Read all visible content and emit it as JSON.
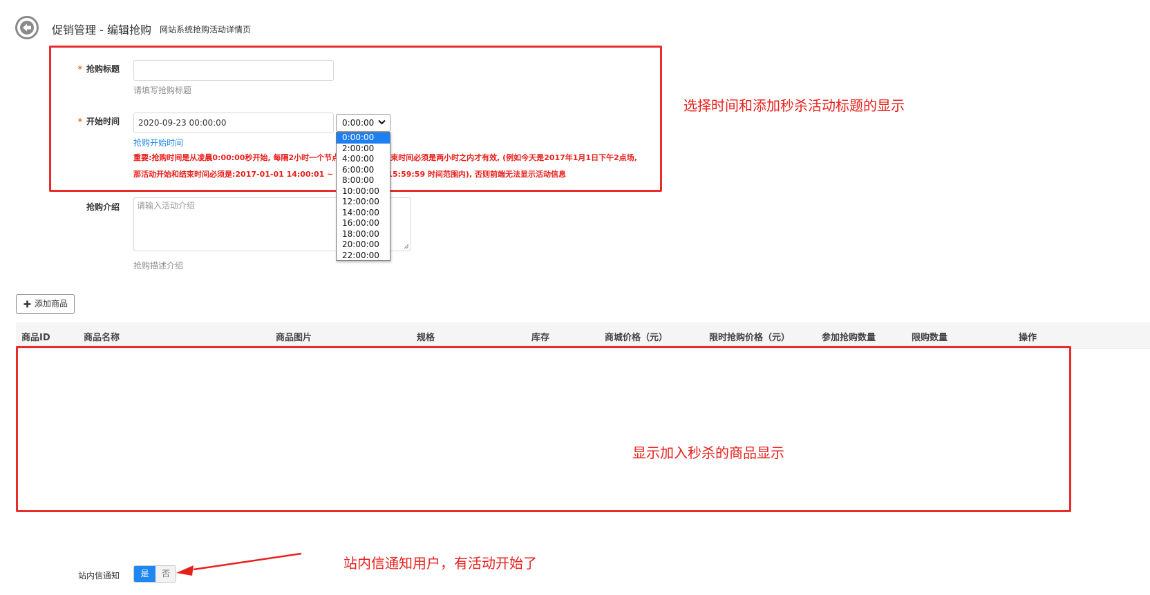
{
  "header": {
    "title": "促销管理 - 编辑抢购",
    "subtitle": "网站系统抢购活动详情页"
  },
  "form": {
    "title_field": {
      "required_mark": "*",
      "label": "抢购标题",
      "value": "",
      "help": "请填写抢购标题"
    },
    "start_time": {
      "required_mark": "*",
      "label": "开始时间",
      "value": "2020-09-23 00:00:00",
      "selected_slot": "0:00:00",
      "help": "抢购开始时间",
      "warning_line1": "重要:抢购时间是从凌晨0:00:00秒开始, 每隔2小时一个节点, 活动开始和结束时间必须是两小时之内才有效, (例如今天是2017年1月1日下午2点场,",
      "warning_line2": "那活动开始和结束时间必须是:2017-01-01 14:00:01 ~ 2017-01-01 15:59:59 时间范围内), 否则前端无法显示活动信息",
      "slot_options": [
        "0:00:00",
        "2:00:00",
        "4:00:00",
        "6:00:00",
        "8:00:00",
        "10:00:00",
        "12:00:00",
        "14:00:00",
        "16:00:00",
        "18:00:00",
        "20:00:00",
        "22:00:00"
      ]
    },
    "intro": {
      "label": "抢购介绍",
      "placeholder": "请输入活动介绍",
      "help": "抢购描述介绍"
    }
  },
  "add_goods_button": "添加商品",
  "table": {
    "columns": [
      "商品ID",
      "商品名称",
      "商品图片",
      "规格",
      "库存",
      "商城价格（元）",
      "限时抢购价格（元）",
      "参加抢购数量",
      "限购数量",
      "操作"
    ]
  },
  "notify": {
    "label": "站内信通知",
    "yes": "是",
    "no": "否",
    "value": "是"
  },
  "annotations": {
    "note_time_title": "选择时间和添加秒杀活动标题的显示",
    "note_goods": "显示加入秒杀的商品显示",
    "note_notify": "站内信通知用户，有活动开始了"
  },
  "colors": {
    "annotation_red": "#ea2b2b",
    "accent_blue": "#1e88f0",
    "required_orange": "#e4711b"
  },
  "icons": [
    "back-arrow-icon",
    "chevron-down-icon",
    "plus-icon",
    "resize-grip-icon",
    "red-arrow-icon"
  ]
}
